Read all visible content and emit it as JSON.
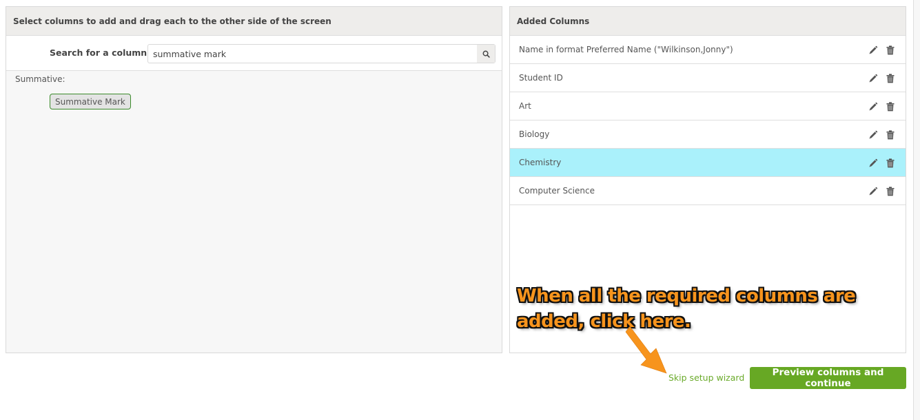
{
  "left_panel": {
    "header": "Select columns to add and drag each to the other side of the screen",
    "search": {
      "label": "Search for a column:",
      "value": "summative mark",
      "placeholder": "",
      "button_icon": "search-icon"
    },
    "groups": [
      {
        "label": "Summative:",
        "items": [
          "Summative Mark"
        ]
      }
    ]
  },
  "right_panel": {
    "header": "Added Columns",
    "columns": [
      {
        "label": "Name in format Preferred Name (\"Wilkinson,Jonny\")",
        "highlighted": false
      },
      {
        "label": "Student ID",
        "highlighted": false
      },
      {
        "label": "Art",
        "highlighted": false
      },
      {
        "label": "Biology",
        "highlighted": false
      },
      {
        "label": "Chemistry",
        "highlighted": true
      },
      {
        "label": "Computer Science",
        "highlighted": false
      }
    ],
    "row_actions": [
      "edit-icon",
      "delete-icon"
    ]
  },
  "annotation": {
    "line1": "When all the required columns are",
    "line2": "added, click here."
  },
  "footer": {
    "skip_label": "Skip setup wizard",
    "primary_label": "Preview columns and continue"
  },
  "colors": {
    "accent_green": "#67a824",
    "link_green": "#6aaa2a",
    "highlight_row": "#aaf1fb",
    "annotation_orange": "#f7941d",
    "chip_border": "#3a8a2a"
  }
}
